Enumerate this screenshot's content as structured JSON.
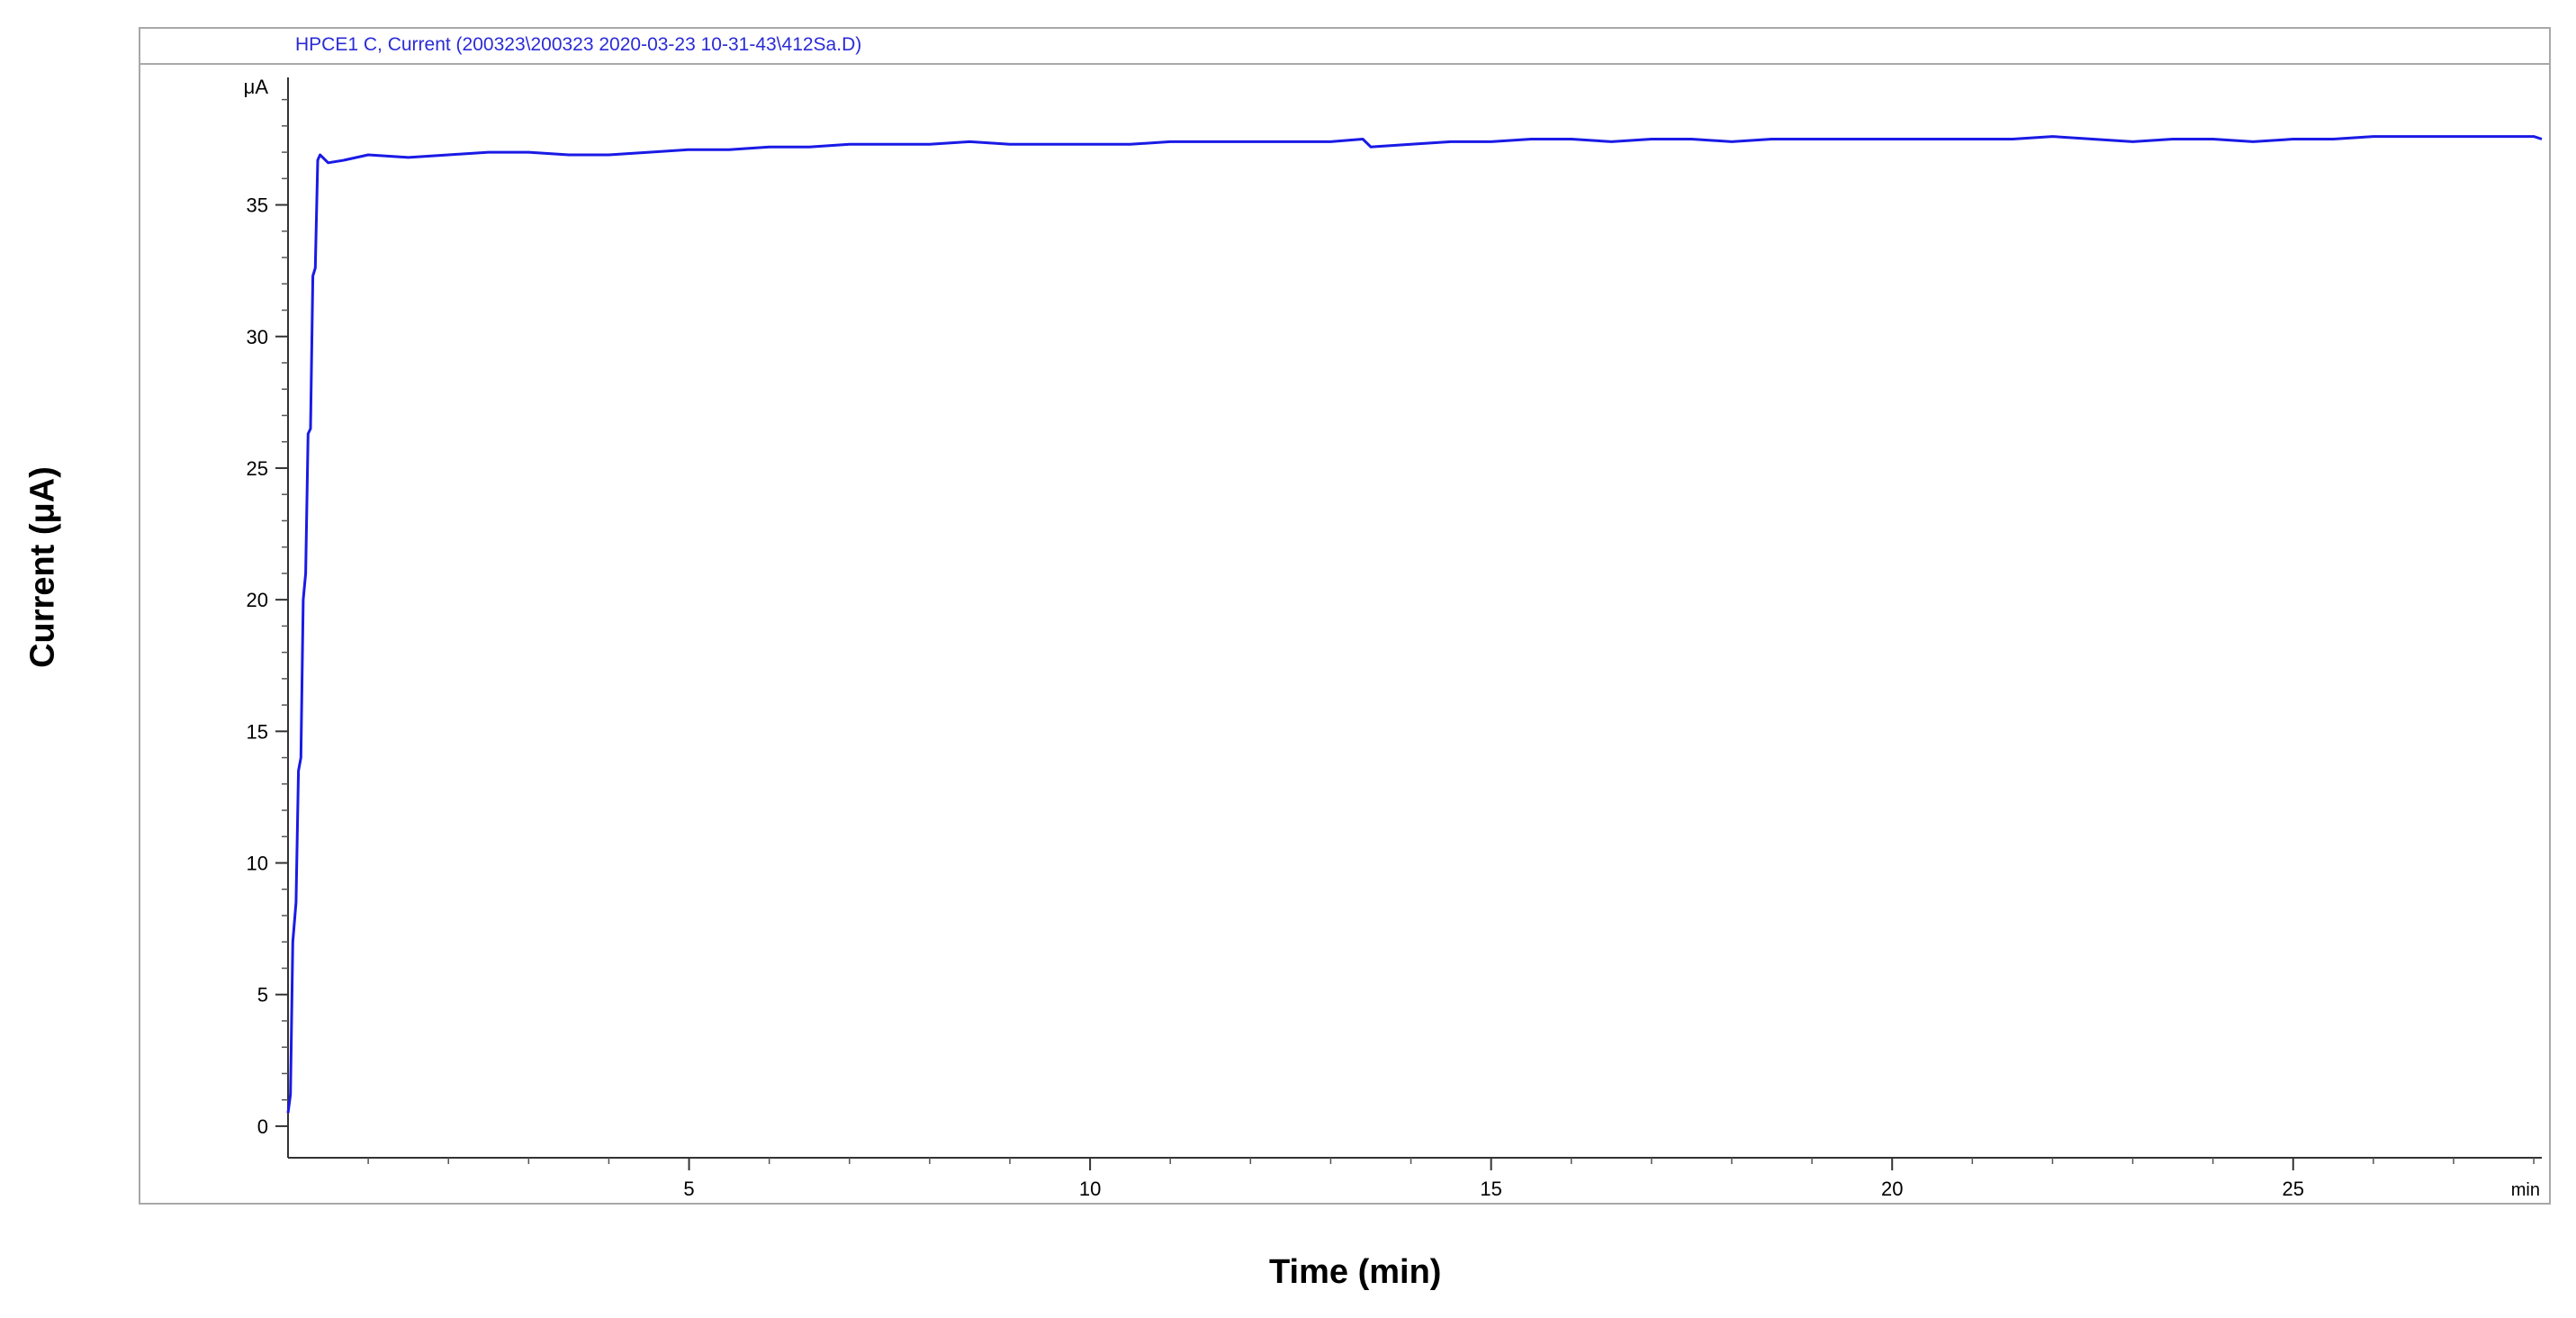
{
  "header": {
    "trace_title": "HPCE1 C, Current (200323\\200323 2020-03-23 10-31-43\\412Sa.D)"
  },
  "chart_data": {
    "type": "line",
    "title": "",
    "xlabel": "Time (min)",
    "ylabel": "Current (μA)",
    "x_unit_label": "min",
    "y_unit_label": "μA",
    "xlim": [
      0,
      28.1
    ],
    "ylim": [
      -1.2,
      39.5
    ],
    "x_ticks": [
      5,
      10,
      15,
      20,
      25
    ],
    "x_tick_labels": [
      "5",
      "10",
      "15",
      "20",
      "25"
    ],
    "x_minor_step": 1,
    "y_ticks": [
      0,
      5,
      10,
      15,
      20,
      25,
      30,
      35
    ],
    "y_tick_labels": [
      "0",
      "5",
      "10",
      "15",
      "20",
      "25",
      "30",
      "35"
    ],
    "y_minor_step": 1,
    "grid": false,
    "line_color": "#1a1ae6",
    "series": [
      {
        "name": "",
        "x": [
          0.0,
          0.03,
          0.06,
          0.1,
          0.13,
          0.16,
          0.19,
          0.22,
          0.25,
          0.28,
          0.31,
          0.34,
          0.37,
          0.4,
          0.5,
          0.7,
          1.0,
          1.5,
          2.0,
          2.5,
          3.0,
          3.5,
          4.0,
          4.5,
          5.0,
          5.5,
          6.0,
          6.5,
          7.0,
          7.5,
          8.0,
          8.5,
          9.0,
          9.5,
          10.0,
          10.5,
          11.0,
          11.5,
          12.0,
          12.5,
          13.0,
          13.4,
          13.5,
          14.0,
          14.5,
          15.0,
          15.5,
          16.0,
          16.5,
          17.0,
          17.5,
          18.0,
          18.5,
          19.0,
          19.5,
          20.0,
          20.5,
          21.0,
          21.5,
          22.0,
          22.5,
          23.0,
          23.5,
          24.0,
          24.5,
          25.0,
          25.5,
          26.0,
          26.5,
          27.0,
          27.5,
          28.0,
          28.1
        ],
        "y": [
          0.5,
          1.2,
          7.0,
          8.5,
          13.5,
          14.0,
          20.0,
          21.0,
          26.3,
          26.5,
          32.3,
          32.6,
          36.7,
          36.9,
          36.6,
          36.7,
          36.9,
          36.8,
          36.9,
          37.0,
          37.0,
          36.9,
          36.9,
          37.0,
          37.1,
          37.1,
          37.2,
          37.2,
          37.3,
          37.3,
          37.3,
          37.4,
          37.3,
          37.3,
          37.3,
          37.3,
          37.4,
          37.4,
          37.4,
          37.4,
          37.4,
          37.5,
          37.2,
          37.3,
          37.4,
          37.4,
          37.5,
          37.5,
          37.4,
          37.5,
          37.5,
          37.4,
          37.5,
          37.5,
          37.5,
          37.5,
          37.5,
          37.5,
          37.5,
          37.6,
          37.5,
          37.4,
          37.5,
          37.5,
          37.4,
          37.5,
          37.5,
          37.6,
          37.6,
          37.6,
          37.6,
          37.6,
          37.5
        ]
      }
    ]
  }
}
